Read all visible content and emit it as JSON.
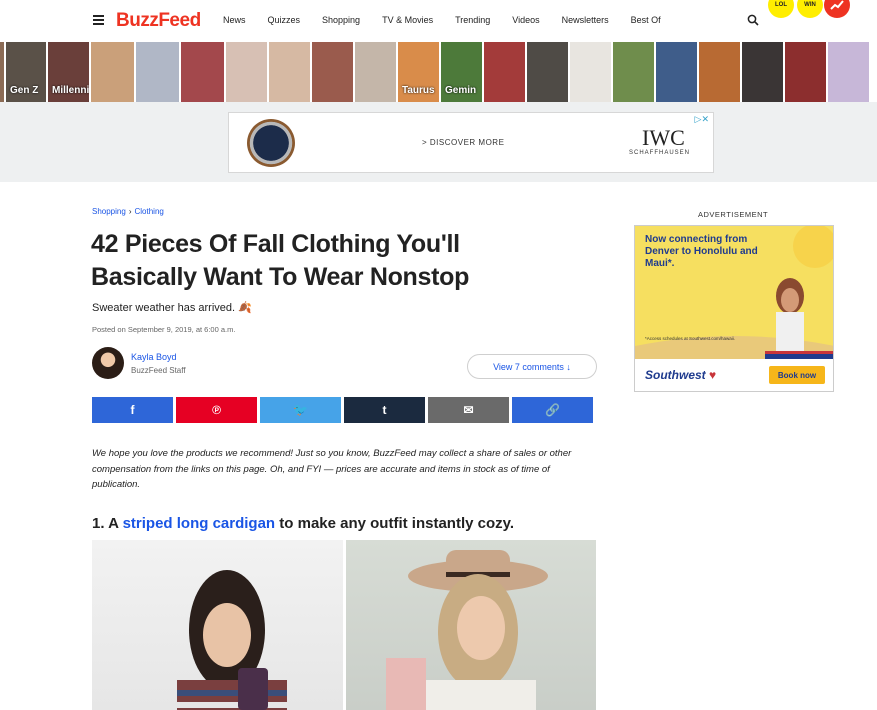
{
  "nav": {
    "logo": "BuzzFeed",
    "links": [
      "News",
      "Quizzes",
      "Shopping",
      "TV & Movies",
      "Trending",
      "Videos",
      "Newsletters",
      "Best Of"
    ]
  },
  "badges": [
    "LOL",
    "WIN",
    ""
  ],
  "thumbs": [
    {
      "label": "",
      "color": "#8b6b55"
    },
    {
      "label": "Gen Z",
      "color": "#5a5148"
    },
    {
      "label": "Millennia",
      "color": "#6a3f3a"
    },
    {
      "label": "",
      "color": "#caa07a"
    },
    {
      "label": "",
      "color": "#b0b7c6"
    },
    {
      "label": "",
      "color": "#a3484c"
    },
    {
      "label": "",
      "color": "#d7c0b4"
    },
    {
      "label": "",
      "color": "#d6b9a3"
    },
    {
      "label": "",
      "color": "#9a5b4d"
    },
    {
      "label": "",
      "color": "#c4b6a9"
    },
    {
      "label": "Taurus",
      "color": "#d98c4a"
    },
    {
      "label": "Gemin",
      "color": "#4d7a3a"
    },
    {
      "label": "",
      "color": "#a33b3a"
    },
    {
      "label": "",
      "color": "#4f4b46"
    },
    {
      "label": "",
      "color": "#e8e5e0"
    },
    {
      "label": "",
      "color": "#6f8d4c"
    },
    {
      "label": "",
      "color": "#3f5d8a"
    },
    {
      "label": "",
      "color": "#b86a33"
    },
    {
      "label": "",
      "color": "#3a3535"
    },
    {
      "label": "",
      "color": "#8c2e2e"
    },
    {
      "label": "",
      "color": "#c7b7d8"
    }
  ],
  "banner_ad": {
    "cta": "> DISCOVER MORE",
    "brand": "IWC",
    "brand_sub": "SCHAFFHAUSEN"
  },
  "article": {
    "breadcrumb": [
      "Shopping",
      "Clothing"
    ],
    "title": "42 Pieces Of Fall Clothing You'll Basically Want To Wear Nonstop",
    "dek": "Sweater weather has arrived. 🍂",
    "posted": "Posted on September 9, 2019, at 6:00 a.m.",
    "author_name": "Kayla Boyd",
    "author_role": "BuzzFeed Staff",
    "comments_button": "View 7 comments ↓",
    "share": [
      {
        "icon": "facebook-icon",
        "glyph": "f",
        "color": "#2e66d8"
      },
      {
        "icon": "pinterest-icon",
        "glyph": "℗",
        "color": "#e60023"
      },
      {
        "icon": "twitter-icon",
        "glyph": "🐦",
        "color": "#46a3e8"
      },
      {
        "icon": "tumblr-icon",
        "glyph": "t",
        "color": "#1b2a3f"
      },
      {
        "icon": "email-icon",
        "glyph": "✉",
        "color": "#6a6a6a"
      },
      {
        "icon": "link-icon",
        "glyph": "🔗",
        "color": "#2e66d8"
      }
    ],
    "disclaimer": "We hope you love the products we recommend! Just so you know, BuzzFeed may collect a share of sales or other compensation from the links on this page. Oh, and FYI — prices are accurate and items in stock as of time of publication.",
    "item_number": "1. A ",
    "item_link": "striped long cardigan",
    "item_rest": " to make any outfit instantly cozy."
  },
  "sidebar": {
    "ad_label": "ADVERTISEMENT",
    "headline": "Now connecting from Denver to Honolulu and Maui*.",
    "fine_print": "*Access schedules at Southwest.com/hawaii.",
    "brand": "Southwest",
    "button": "Book now"
  }
}
